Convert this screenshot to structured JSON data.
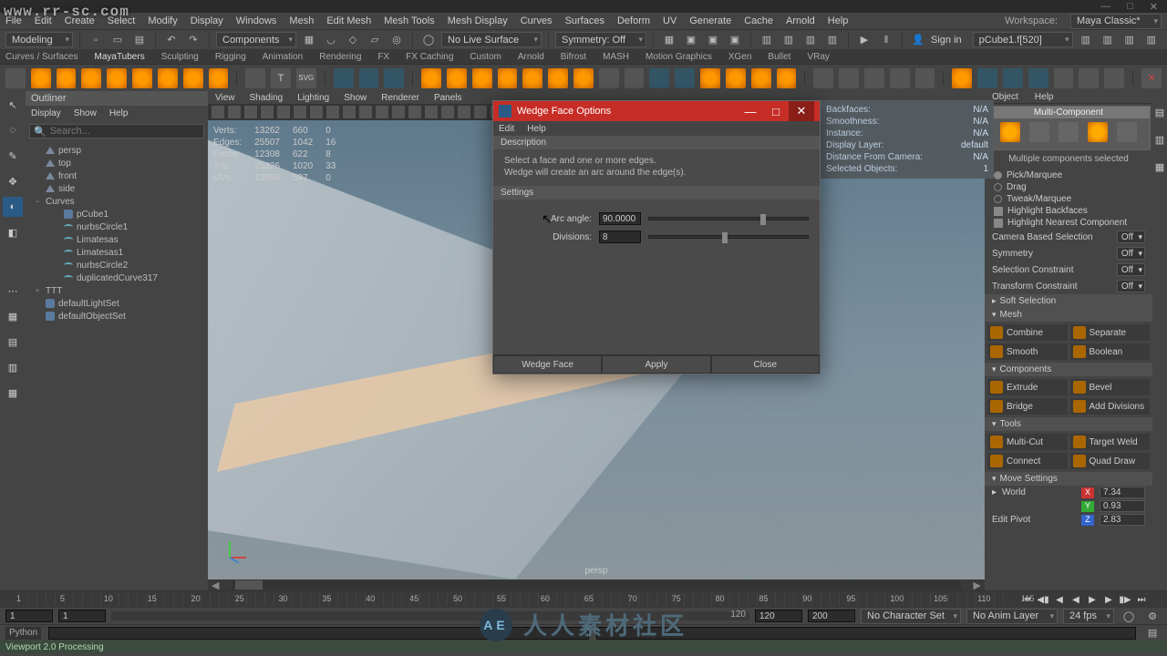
{
  "watermark": "www.rr-sc.com",
  "bottom_watermark": "人人素材社区",
  "titlebar": [
    "—",
    "□",
    "✕"
  ],
  "menu": [
    "File",
    "Edit",
    "Create",
    "Select",
    "Modify",
    "Display",
    "Windows",
    "Mesh",
    "Edit Mesh",
    "Mesh Tools",
    "Mesh Display",
    "Curves",
    "Surfaces",
    "Deform",
    "UV",
    "Generate",
    "Cache",
    "Arnold",
    "Help"
  ],
  "workspace_label": "Workspace:",
  "workspace_value": "Maya Classic*",
  "mode": "Modeling",
  "row2": {
    "components": "Components",
    "no_live": "No Live Surface",
    "symmetry": "Symmetry: Off",
    "signin": "Sign in",
    "object": "pCube1.f[520]"
  },
  "shelf_tabs": [
    "Curves / Surfaces",
    "MayaTubers",
    "Sculpting",
    "Rigging",
    "Animation",
    "Rendering",
    "FX",
    "FX Caching",
    "Custom",
    "Arnold",
    "Bifrost",
    "MASH",
    "Motion Graphics",
    "XGen",
    "Bullet",
    "VRay"
  ],
  "outliner": {
    "title": "Outliner",
    "menu": [
      "Display",
      "Show",
      "Help"
    ],
    "search": "Search...",
    "items": [
      {
        "type": "cam",
        "label": "persp"
      },
      {
        "type": "cam",
        "label": "top"
      },
      {
        "type": "cam",
        "label": "front"
      },
      {
        "type": "cam",
        "label": "side"
      },
      {
        "type": "group",
        "label": "Curves",
        "exp": "−",
        "children": [
          {
            "type": "geo",
            "label": "pCube1"
          },
          {
            "type": "curve",
            "label": "nurbsCircle1"
          },
          {
            "type": "curve",
            "label": "Limatesas"
          },
          {
            "type": "curve",
            "label": "Limatesas1"
          },
          {
            "type": "curve",
            "label": "nurbsCircle2"
          },
          {
            "type": "curve",
            "label": "duplicatedCurve317"
          }
        ]
      },
      {
        "type": "group",
        "label": "TTT",
        "exp": "+"
      },
      {
        "type": "set",
        "label": "defaultLightSet"
      },
      {
        "type": "set",
        "label": "defaultObjectSet"
      }
    ]
  },
  "viewport_menu": [
    "View",
    "Shading",
    "Lighting",
    "Show",
    "Renderer",
    "Panels"
  ],
  "hud": {
    "rows": [
      [
        "Verts:",
        "13262",
        "660",
        "0"
      ],
      [
        "Edges:",
        "25507",
        "1042",
        "16"
      ],
      [
        "Faces:",
        "12308",
        "622",
        "8"
      ],
      [
        "Tris:",
        "25326",
        "1020",
        "33"
      ],
      [
        "UVs:",
        "13850",
        "597",
        "0"
      ]
    ]
  },
  "persp": "persp",
  "right_tabs": [
    "Object",
    "Help"
  ],
  "multi": {
    "title": "Multi-Component",
    "msg": "Multiple components selected"
  },
  "opts": [
    {
      "t": "radio",
      "on": true,
      "label": "Pick/Marquee"
    },
    {
      "t": "radio",
      "on": false,
      "label": "Drag"
    },
    {
      "t": "radio",
      "on": false,
      "label": "Tweak/Marquee"
    },
    {
      "t": "chk",
      "on": true,
      "label": "Highlight Backfaces"
    },
    {
      "t": "chk",
      "on": true,
      "label": "Highlight Nearest Component"
    }
  ],
  "drops": [
    {
      "label": "Camera Based Selection",
      "val": "Off"
    },
    {
      "label": "Symmetry",
      "val": "Off"
    },
    {
      "label": "Selection Constraint",
      "val": "Off"
    },
    {
      "label": "Transform Constraint",
      "val": "Off"
    }
  ],
  "soft": "Soft Selection",
  "sections": {
    "mesh": {
      "title": "Mesh",
      "tools": [
        [
          "Combine",
          "Separate"
        ],
        [
          "Smooth",
          "Boolean"
        ]
      ]
    },
    "components": {
      "title": "Components",
      "tools": [
        [
          "Extrude",
          "Bevel"
        ],
        [
          "Bridge",
          "Add Divisions"
        ]
      ]
    },
    "tools": {
      "title": "Tools",
      "tools": [
        [
          "Multi-Cut",
          "Target Weld"
        ],
        [
          "Connect",
          "Quad Draw"
        ]
      ]
    },
    "move": {
      "title": "Move Settings",
      "world": "World",
      "axes": [
        [
          "X",
          "7.34"
        ],
        [
          "Y",
          "0.93"
        ],
        [
          "Z",
          "2.83"
        ]
      ],
      "pivot": "Edit Pivot"
    }
  },
  "prop_panel": [
    [
      "Backfaces:",
      "N/A"
    ],
    [
      "Smoothness:",
      "N/A"
    ],
    [
      "Instance:",
      "N/A"
    ],
    [
      "Display Layer:",
      "default"
    ],
    [
      "Distance From Camera:",
      "N/A"
    ],
    [
      "Selected Objects:",
      "1"
    ]
  ],
  "dialog": {
    "title": "Wedge Face Options",
    "menu": [
      "Edit",
      "Help"
    ],
    "section1": "Description",
    "desc1": "Select a face and one or more edges.",
    "desc2": "Wedge will create an arc around the edge(s).",
    "section2": "Settings",
    "arc_label": "Arc angle:",
    "arc_value": "90.0000",
    "div_label": "Divisions:",
    "div_value": "8",
    "btns": [
      "Wedge Face",
      "Apply",
      "Close"
    ]
  },
  "timeline": {
    "start1": "1",
    "start2": "1",
    "pos": "1",
    "posnum": "120",
    "end1": "120",
    "end2": "200",
    "charset": "No Character Set",
    "anim": "No Anim Layer",
    "fps": "24 fps",
    "ticks": [
      "1",
      "5",
      "10",
      "15",
      "20",
      "25",
      "30",
      "35",
      "40",
      "45",
      "50",
      "55",
      "60",
      "65",
      "70",
      "75",
      "80",
      "85",
      "90",
      "95",
      "100",
      "105",
      "110",
      "115"
    ]
  },
  "cmd": {
    "lang": "Python",
    "status": "Viewport 2.0 Processing"
  }
}
